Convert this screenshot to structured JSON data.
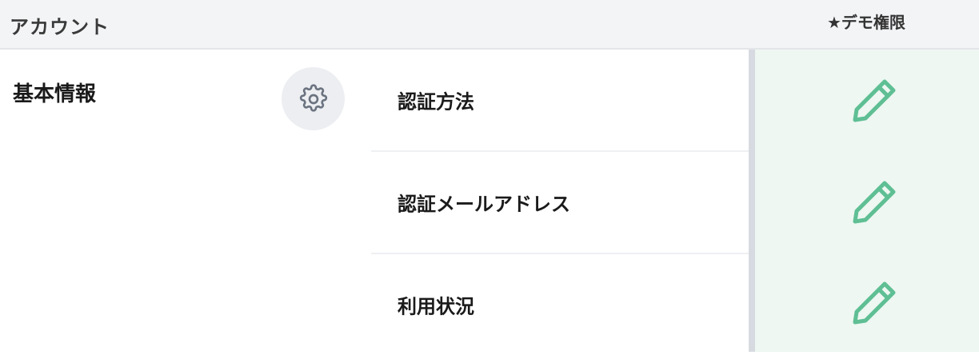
{
  "header": {
    "title": "アカウント",
    "permission_label": "★デモ権限"
  },
  "section": {
    "label": "基本情報",
    "settings_icon": "gear-icon"
  },
  "rows": [
    {
      "label": "認証方法",
      "action_icon": "pencil-icon"
    },
    {
      "label": "認証メールアドレス",
      "action_icon": "pencil-icon"
    },
    {
      "label": "利用状況",
      "action_icon": "pencil-icon"
    }
  ],
  "colors": {
    "header_bg": "#f3f4f6",
    "permission_column_bg": "#eef7f2",
    "pencil": "#5fbf94",
    "gear": "#6b7380"
  }
}
